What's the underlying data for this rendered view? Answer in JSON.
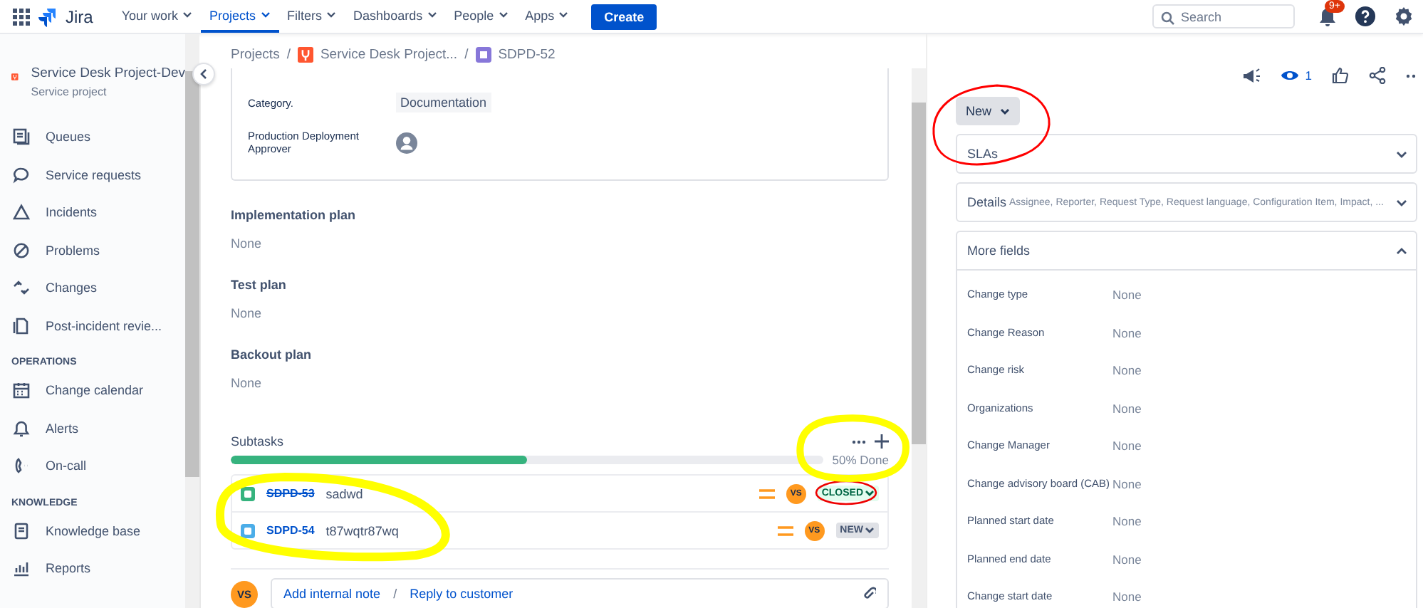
{
  "topnav": {
    "logo": "Jira",
    "menus": [
      {
        "label": "Your work",
        "selected": false
      },
      {
        "label": "Projects",
        "selected": true
      },
      {
        "label": "Filters",
        "selected": false
      },
      {
        "label": "Dashboards",
        "selected": false
      },
      {
        "label": "People",
        "selected": false
      },
      {
        "label": "Apps",
        "selected": false
      }
    ],
    "create": "Create",
    "search": {
      "placeholder": "Search"
    },
    "notification_badge": "9+"
  },
  "sidebar": {
    "project": {
      "name": "Service Desk Project-Dev",
      "type": "Service project"
    },
    "sections": [
      {
        "items": [
          {
            "label": "Queues"
          },
          {
            "label": "Service requests"
          },
          {
            "label": "Incidents"
          },
          {
            "label": "Problems"
          },
          {
            "label": "Changes"
          },
          {
            "label": "Post-incident revie..."
          }
        ]
      },
      {
        "heading": "OPERATIONS",
        "items": [
          {
            "label": "Change calendar"
          },
          {
            "label": "Alerts"
          },
          {
            "label": "On-call"
          }
        ]
      },
      {
        "heading": "KNOWLEDGE",
        "items": [
          {
            "label": "Knowledge base"
          },
          {
            "label": "Reports"
          }
        ]
      }
    ]
  },
  "breadcrumbs": [
    "Projects",
    "Service Desk Project...",
    "SDPD-52"
  ],
  "breadcrumb_separator": "/",
  "card_fields": [
    {
      "label": "Category.",
      "kind": "tag",
      "value": "Documentation"
    },
    {
      "label": "Production Deployment Approver",
      "kind": "avatar"
    }
  ],
  "plans": [
    {
      "label": "Implementation plan",
      "value": "None"
    },
    {
      "label": "Test plan",
      "value": "None"
    },
    {
      "label": "Backout plan",
      "value": "None"
    }
  ],
  "subtasks": {
    "title": "Subtasks",
    "level": 0.5,
    "progress_text": "50% Done",
    "rows": [
      {
        "key": "SDPD-53",
        "summary": "sadwd",
        "done": true,
        "assignee": "VS",
        "status": "CLOSED"
      },
      {
        "key": "SDPD-54",
        "summary": "t87wqtr87wq",
        "done": false,
        "assignee": "VS",
        "status": "NEW"
      }
    ]
  },
  "comment": {
    "avatar": "VS",
    "links": [
      "Add internal note",
      "Reply to customer"
    ],
    "separator": "/"
  },
  "right": {
    "watchers": "1",
    "status": "New",
    "panels": [
      {
        "title": "SLAs",
        "expanded": false
      },
      {
        "title": "Details",
        "summary": "Assignee, Reporter, Request Type, Request language, Configuration Item, Impact, ...",
        "expanded": false
      },
      {
        "title": "More fields",
        "expanded": true,
        "fields": [
          {
            "label": "Change type",
            "value": "None"
          },
          {
            "label": "Change Reason",
            "value": "None"
          },
          {
            "label": "Change risk",
            "value": "None"
          },
          {
            "label": "Organizations",
            "value": "None"
          },
          {
            "label": "Change Manager",
            "value": "None"
          },
          {
            "label": "Change advisory board (CAB)",
            "value": "None"
          },
          {
            "label": "Planned start date",
            "value": "None"
          },
          {
            "label": "Planned end date",
            "value": "None"
          },
          {
            "label": "Change start date",
            "value": "None"
          }
        ]
      }
    ]
  }
}
